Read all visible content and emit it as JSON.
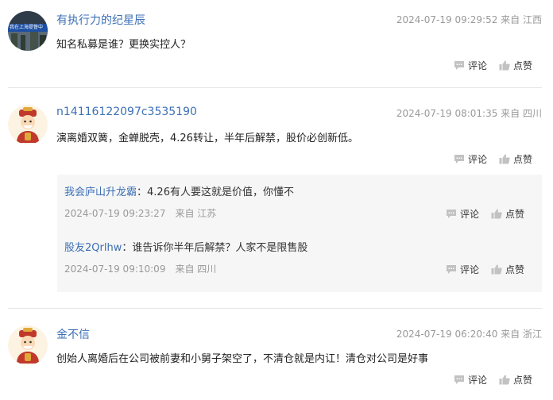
{
  "comments": [
    {
      "user": "有执行力的纪星辰",
      "time": "2024-07-19 09:29:52",
      "location": "来自 江西",
      "content": "知名私募是谁？更换实控人？",
      "comment_label": "评论",
      "like_label": "点赞",
      "avatar_caption": "我在上海提督中"
    },
    {
      "user": "n14116122097c3535190",
      "time": "2024-07-19 08:01:35",
      "location": "来自 四川",
      "content": "演离婚双簧，金蝉脱壳，4.26转让，半年后解禁，股价必创新低。",
      "comment_label": "评论",
      "like_label": "点赞",
      "replies": [
        {
          "user": "我会庐山升龙霸",
          "content": "：4.26有人要这就是价值，你懂不",
          "time": "2024-07-19 09:23:27",
          "location": "来自 江苏",
          "comment_label": "评论",
          "like_label": "点赞"
        },
        {
          "user": "股友2Qrlhw",
          "content": "：谁告诉你半年后解禁？人家不是限售股",
          "time": "2024-07-19 09:10:09",
          "location": "来自 四川",
          "comment_label": "评论",
          "like_label": "点赞"
        }
      ]
    },
    {
      "user": "金不信",
      "time": "2024-07-19 06:20:40",
      "location": "来自 浙江",
      "content": "创始人离婚后在公司被前妻和小舅子架空了，不清仓就是内讧！清仓对公司是好事",
      "comment_label": "评论",
      "like_label": "点赞"
    }
  ],
  "colors": {
    "username": "#3b6fb6",
    "meta": "#999999",
    "reply_bg": "#f6f6f6",
    "divider": "#e6e6e6"
  },
  "icons": {
    "comment": "comment-bubble-icon",
    "like": "thumbs-up-icon"
  }
}
